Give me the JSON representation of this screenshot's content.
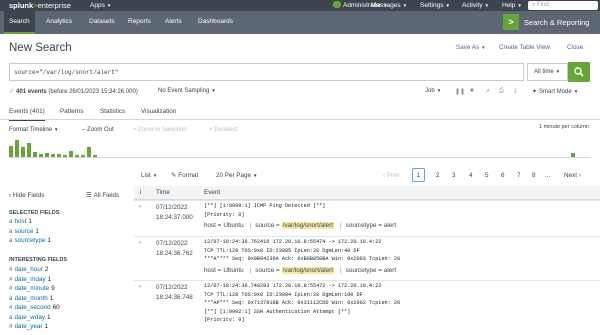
{
  "topbar": {
    "logo_brand": "splunk",
    "logo_gt": ">",
    "logo_edition": "enterprise",
    "apps": "Apps",
    "administrator": "Administrator",
    "messages": "Messages",
    "settings": "Settings",
    "activity": "Activity",
    "help": "Help",
    "find_placeholder": "Find"
  },
  "appbar": {
    "nav": [
      "Search",
      "Analytics",
      "Datasets",
      "Reports",
      "Alerts",
      "Dashboards"
    ],
    "active": "Search",
    "app_title": "Search & Reporting"
  },
  "page": {
    "title": "New Search",
    "save_as": "Save As",
    "create_table_view": "Create Table View",
    "close": "Close"
  },
  "search": {
    "query": "source=\"/var/log/snort/alert\"",
    "time_range": "All time"
  },
  "status": {
    "event_count": "401 events",
    "before_text": "(before 26/01/2023 15:34:26.000)",
    "sampling": "No Event Sampling",
    "job": "Job",
    "mode": "Smart Mode"
  },
  "tabs": [
    "Events (401)",
    "Patterns",
    "Statistics",
    "Visualization"
  ],
  "timeline": {
    "format": "Format Timeline",
    "zoom_out": "– Zoom Out",
    "zoom_selection": "+ Zoom to Selection",
    "deselect": "× Deselect",
    "scale": "1 minute per column",
    "bars": [
      0.55,
      0.85,
      0.5,
      0.7,
      0.25,
      0.15,
      0.2,
      0.15,
      0.15,
      0.12,
      0.3,
      0.12,
      0.12,
      0.5,
      0.12
    ]
  },
  "results_toolbar": {
    "view": "List",
    "format": "Format",
    "per_page": "20 Per Page",
    "prev": "‹ Prev",
    "pages": [
      "1",
      "2",
      "3",
      "4",
      "5",
      "6",
      "7",
      "8",
      "..."
    ],
    "next": "Next ›",
    "current_page": "1"
  },
  "sidebar": {
    "hide_fields": "‹ Hide Fields",
    "all_fields": "All Fields",
    "selected_heading": "SELECTED FIELDS",
    "selected": [
      {
        "type": "a",
        "name": "host",
        "count": "1"
      },
      {
        "type": "a",
        "name": "source",
        "count": "1"
      },
      {
        "type": "a",
        "name": "sourcetype",
        "count": "1"
      }
    ],
    "interesting_heading": "INTERESTING FIELDS",
    "interesting": [
      {
        "type": "#",
        "name": "date_hour",
        "count": "2"
      },
      {
        "type": "#",
        "name": "date_mday",
        "count": "1"
      },
      {
        "type": "#",
        "name": "date_minute",
        "count": "9"
      },
      {
        "type": "a",
        "name": "date_month",
        "count": "1"
      },
      {
        "type": "#",
        "name": "date_second",
        "count": "60"
      },
      {
        "type": "a",
        "name": "date_wday",
        "count": "1"
      },
      {
        "type": "#",
        "name": "date_year",
        "count": "1"
      }
    ]
  },
  "table": {
    "col_info": "i",
    "col_time": "Time",
    "col_event": "Event",
    "events": [
      {
        "date": "07/12/2022",
        "time": "18:24:37.000",
        "lines": [
          "[**] [1:9999:1] ICMP Ping Detected [**]",
          "[Priority: 0]"
        ],
        "host": "Ubuntu",
        "source": "/var/log/snort/alert",
        "sourcetype": "alert"
      },
      {
        "date": "07/12/2022",
        "time": "18:24:36.762",
        "lines": [
          "12/07-18:24:36.762416 172.20.10.8:55474 -> 172.20.10.4:22",
          "TCP TTL:128 TOS:0x0 ID:23985 IpLen:20 DgmLen:40 DF",
          "***A**** Seq: 0x9B94236A  Ack: 0xB8B850BA  Win: 0x2003  TcpLen: 20"
        ],
        "host": "Ubuntu",
        "source": "/var/log/snort/alert",
        "sourcetype": "alert"
      },
      {
        "date": "07/12/2022",
        "time": "18:24:36.748",
        "lines": [
          "12/07-18:24:36.748283 172.20.10.8:55472 -> 172.20.10.4:22",
          "TCP TTL:128 TOS:0x0 ID:23984 IpLen:20 DgmLen:100 DF",
          "***AP*** Seq: 0x7137818B  Ack: 0x31112CDD  Win: 0x2002  TcpLen: 20",
          "[**] [1:9992:1] SSH Authentication Attempt [**]",
          "[Priority: 0]"
        ]
      }
    ]
  },
  "labels": {
    "host": "host =",
    "source": "source =",
    "sourcetype": "sourcetype ="
  },
  "colors": {
    "accent": "#65a637",
    "topbar": "#3c444d",
    "appbar": "#5c6773",
    "link": "#006eaa"
  }
}
